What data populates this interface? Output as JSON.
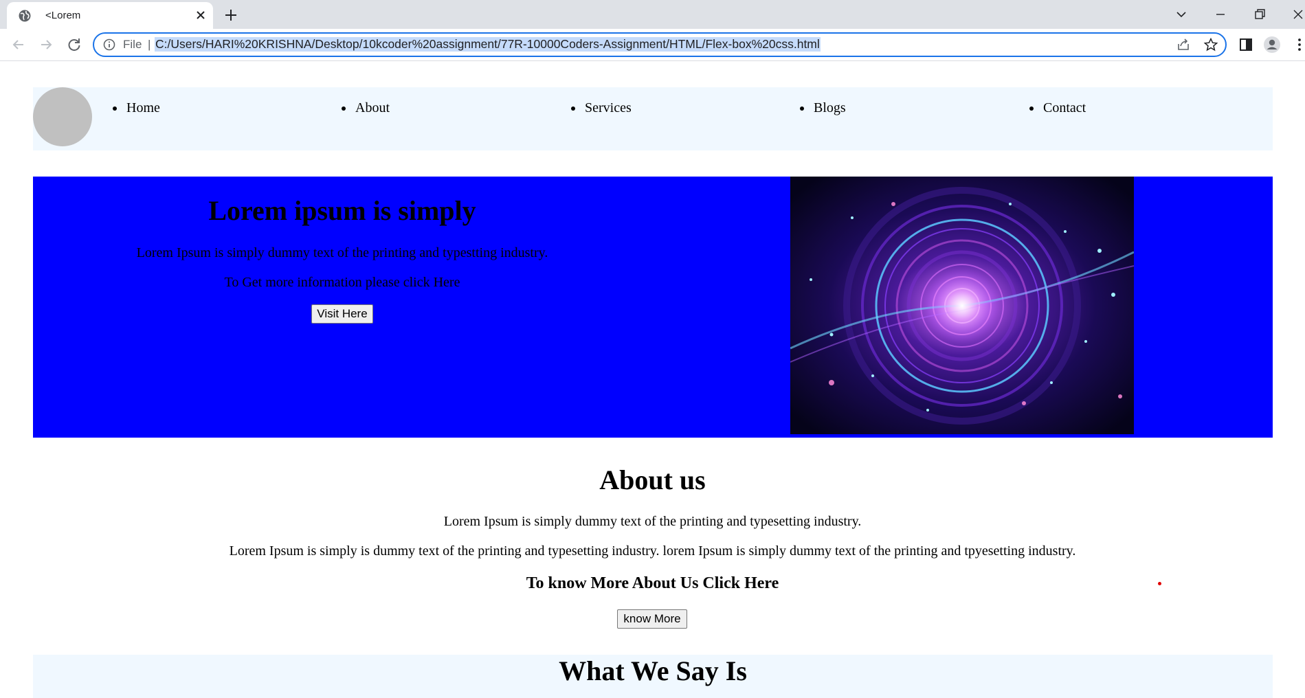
{
  "browser": {
    "tab_title": "<Lorem",
    "omnibox_label": "File",
    "omnibox_separator": "|",
    "url": "C:/Users/HARI%20KRISHNA/Desktop/10kcoder%20assignment/77R-10000Coders-Assignment/HTML/Flex-box%20css.html"
  },
  "nav": {
    "items": [
      {
        "label": "Home"
      },
      {
        "label": "About"
      },
      {
        "label": "Services"
      },
      {
        "label": "Blogs"
      },
      {
        "label": "Contact"
      }
    ]
  },
  "hero": {
    "title": "Lorem ipsum is simply",
    "text1": "Lorem Ipsum is simply dummy text of the printing and typestting industry.",
    "text2": "To Get more information please click Here",
    "button": "Visit Here",
    "image_name": "galaxy-vortex-image",
    "background": "#0000ff"
  },
  "about": {
    "title": "About us",
    "text1": "Lorem Ipsum is simply dummy text of the printing and typesetting industry.",
    "text2": "Lorem Ipsum is simply is dummy text of the printing and typesetting industry. lorem Ipsum is simply dummy text of the printing and tpyesetting industry.",
    "subtitle": "To know More About Us Click Here",
    "button": "know More"
  },
  "say": {
    "title": "What We Say Is",
    "background": "#f0f8ff"
  },
  "icons": [
    "globe-icon",
    "close-icon",
    "plus-icon",
    "chevron-down-icon",
    "minimize-icon",
    "restore-icon",
    "back-icon",
    "forward-icon",
    "reload-icon",
    "info-icon",
    "share-icon",
    "star-icon",
    "side-panel-icon",
    "profile-icon",
    "more-icon"
  ]
}
